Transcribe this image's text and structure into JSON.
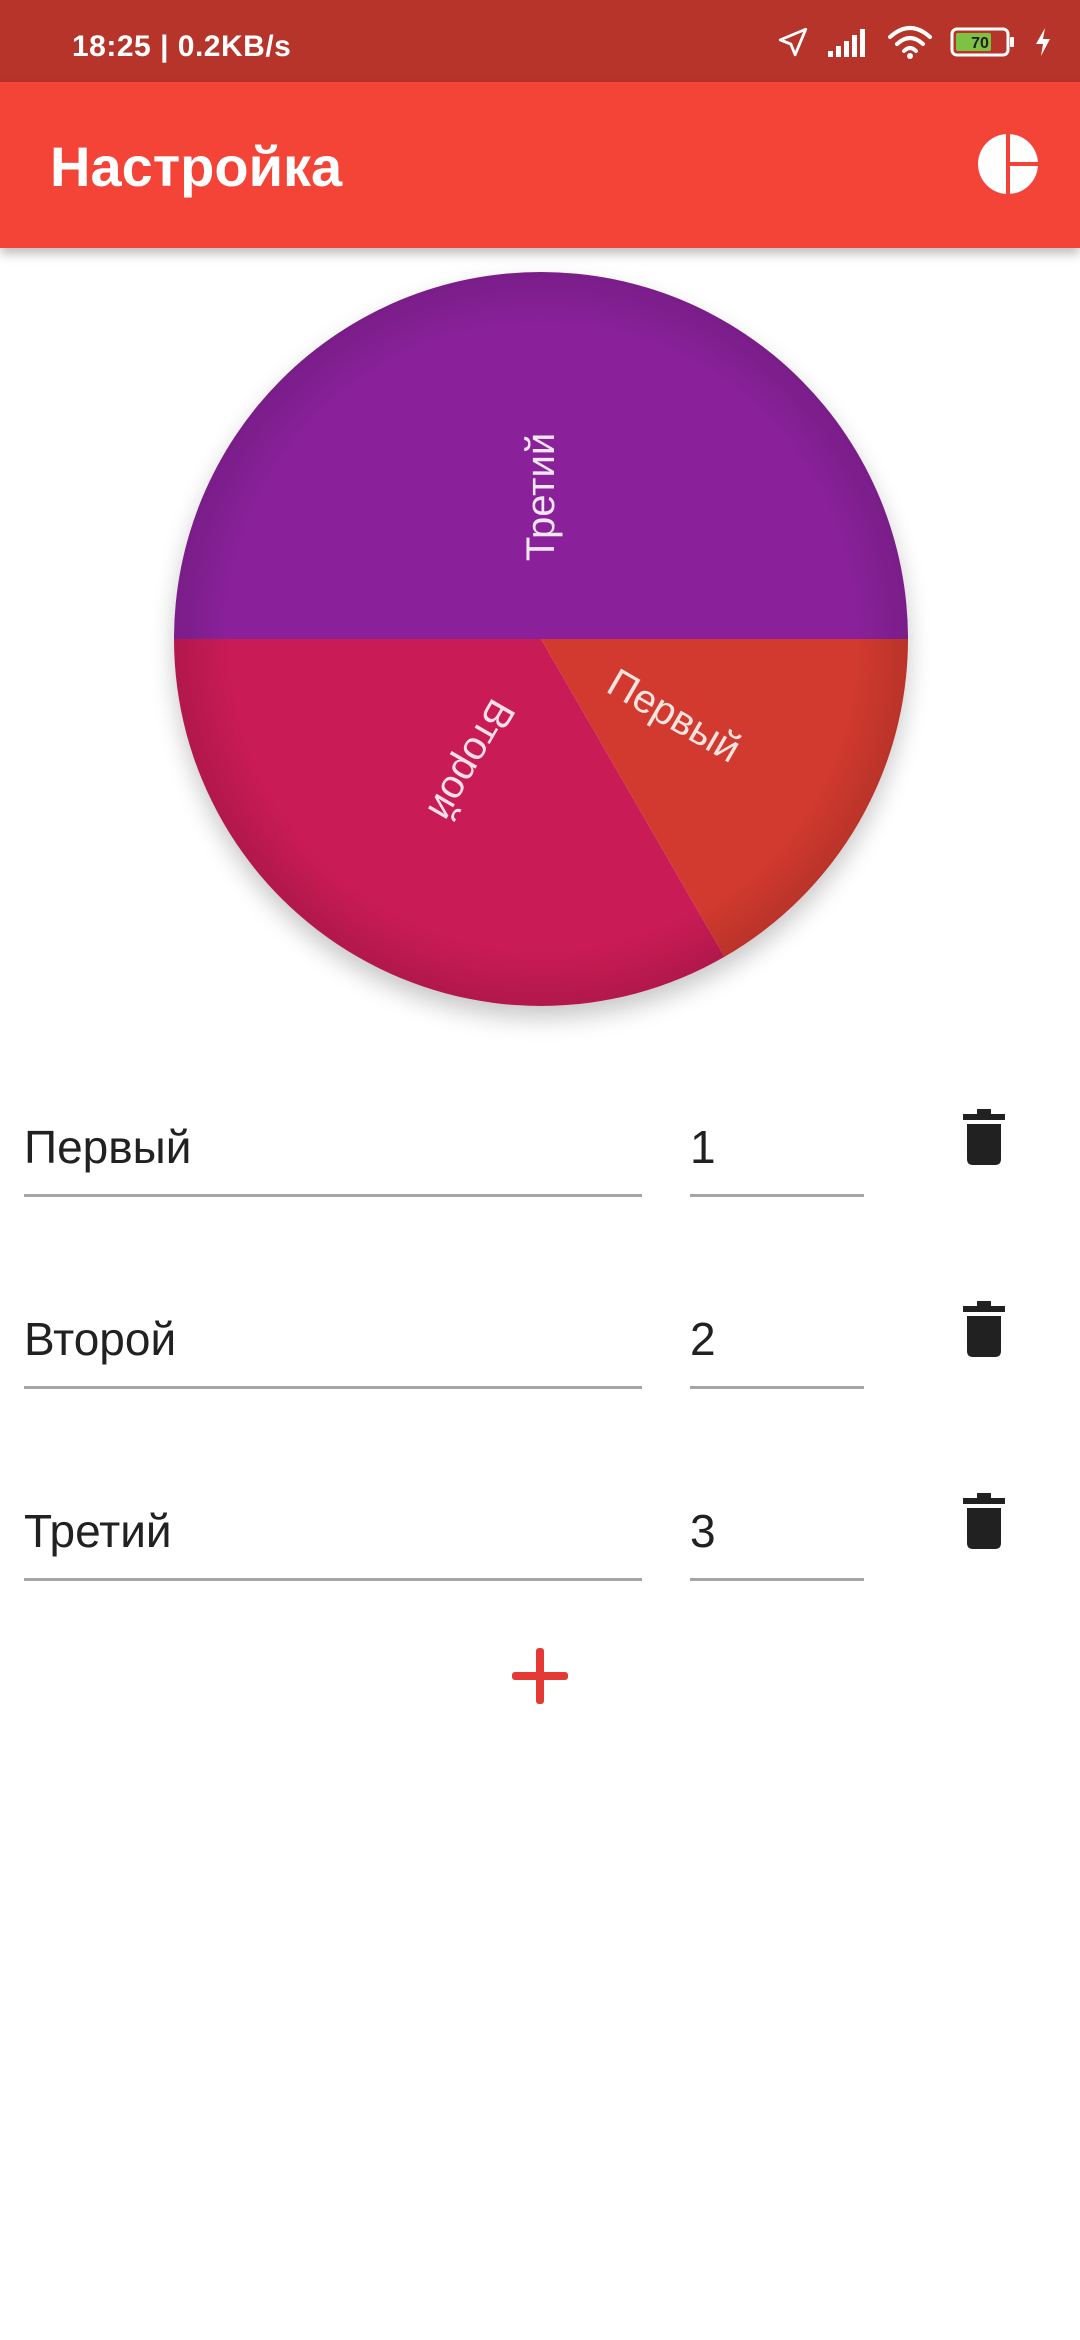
{
  "status_bar": {
    "time": "18:25 | 0.2KB/s",
    "battery": "70",
    "icons": [
      "location-arrow-icon",
      "signal-icon",
      "wifi-icon",
      "battery-icon",
      "charging-icon"
    ]
  },
  "app_bar": {
    "title": "Настройка",
    "action_icon": "pie-chart-icon",
    "background": "#f44337"
  },
  "wheel": {
    "segments": [
      {
        "label": "Первый",
        "value": 1,
        "color": "#d33a2f"
      },
      {
        "label": "Второй",
        "value": 2,
        "color": "#c91b55"
      },
      {
        "label": "Третий",
        "value": 3,
        "color": "#8a219b"
      }
    ]
  },
  "items": [
    {
      "name": "Первый",
      "value": "1",
      "delete_icon": "trash-icon"
    },
    {
      "name": "Второй",
      "value": "2",
      "delete_icon": "trash-icon"
    },
    {
      "name": "Третий",
      "value": "3",
      "delete_icon": "trash-icon"
    }
  ],
  "add_button": {
    "icon": "plus-icon",
    "color": "#e53935"
  }
}
